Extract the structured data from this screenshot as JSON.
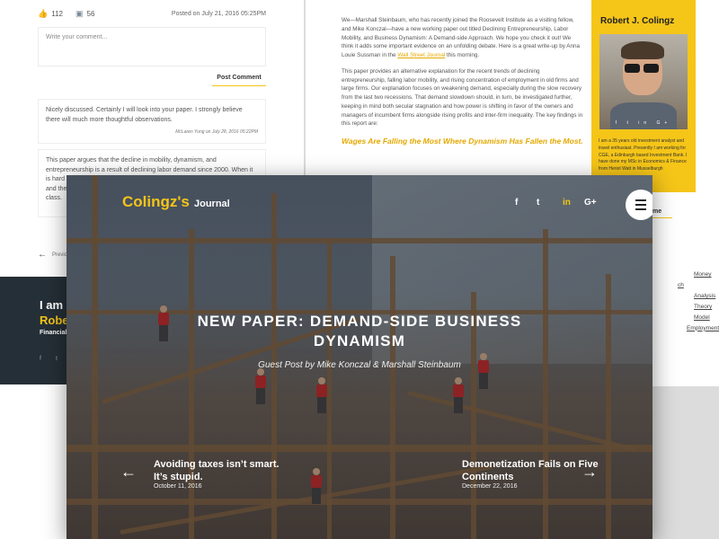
{
  "left_page": {
    "likes": "112",
    "comments_count": "56",
    "posted": "Posted on July 21, 2016 05:25PM",
    "comment_placeholder": "Write your comment...",
    "post_comment": "Post Comment",
    "comments": [
      {
        "text": "Nicely discussed. Certainly I will look into your paper. I strongly believe there will much more thoughtful observations.",
        "byline": "McLaren Yung on July 28, 2016 05:22PM"
      },
      {
        "text": "This paper argues that the decline in mobility, dynamism, and entrepreneurship is a result of declining labor demand since 2000. When it is hard to find another job, employ"
      }
    ],
    "comment_2_line3": "and the a",
    "comment_2_line4": "class.",
    "previous": "Previous",
    "footer": {
      "iam": "I am",
      "name": "Rober",
      "role": "Financial"
    }
  },
  "right_page": {
    "paragraph1_a": "We—Marshall Steinbaum, who has recently joined the Roosevelt Institute as a visiting fellow, and Mike Konczal—have a new working paper out titled Declining Entrepreneurship, Labor Mobility, and Business Dynamism: A Demand-side Approach. We hope you check it out! We think it adds some important evidence on an unfolding debate. Here is a great write-up by Anna Louie Sussman in the ",
    "paragraph1_link": "Wall Street Journal",
    "paragraph1_b": " this morning.",
    "paragraph2": "This paper provides an alternative explanation for the recent trends of declining entrepreneurship, falling labor mobility, and rising concentration of employment in old firms and large firms. Our explanation focuses on weakening demand, especially during the slow recovery from the last two recessions. That demand slowdown should, in turn, be investigated further, keeping in mind both secular stagnation and how power is shifting in favor of the owners and managers of incumbent firms alongside rising profits and inter-firm inequality. The key findings in this report are:",
    "subhead": "Wages Are Falling the Most Where Dynamism Has Fallen the Most.",
    "profile": {
      "name": "Robert J. Colingz",
      "bio": "I am a 35 years old investment analyst and travel enthusiast. Presently I am working for CGE, a Edinburgh based Investment Bank. I have done my MSc in Economics & Finance from Heriot Watt in Musselburgh"
    },
    "side_title": "me",
    "categories": [
      "Money",
      "ch",
      "Analysis",
      "Theory",
      "Model",
      "Employment"
    ]
  },
  "hero": {
    "brand": "Colingz's",
    "brand_sub": "Journal",
    "title": "New Paper: Demand-side Business Dynamism",
    "subtitle": "Guest Post by Mike Konczal & Marshall Steinbaum",
    "prev": {
      "title_line1": "Avoiding taxes isn’t smart.",
      "title_line2": "It’s stupid.",
      "date": "October 11, 2016"
    },
    "next": {
      "title_line1": "Demonetization Fails on Five",
      "title_line2": "Continents",
      "date": "December 22, 2016"
    }
  },
  "colors": {
    "accent": "#f5c518",
    "dark_footer": "#252f37"
  },
  "icons": [
    "thumbs-up-icon",
    "comment-icon",
    "arrow-left-icon",
    "arrow-right-icon",
    "facebook-icon",
    "twitter-icon",
    "linkedin-icon",
    "google-plus-icon",
    "menu-icon"
  ]
}
